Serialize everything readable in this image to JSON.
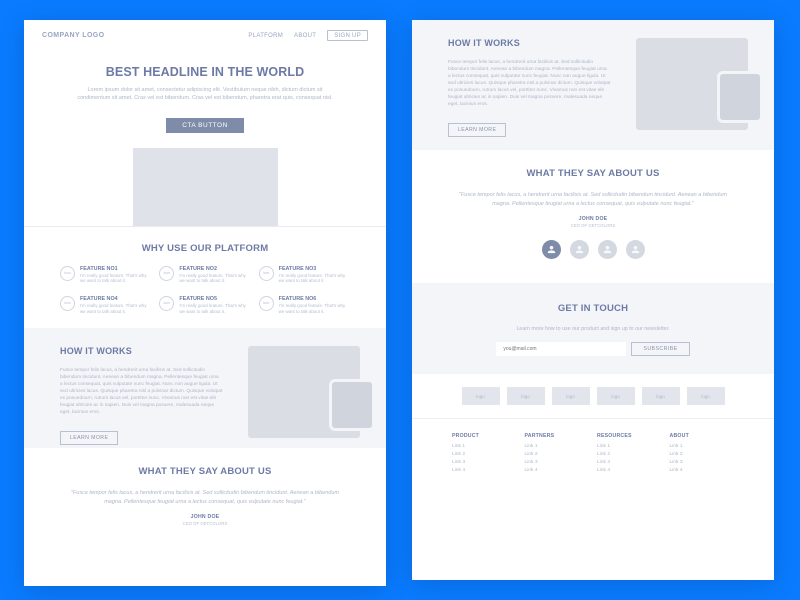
{
  "nav": {
    "logo": "COMPANY LOGO",
    "platform": "PLATFORM",
    "about": "ABOUT",
    "signup": "SIGN UP"
  },
  "hero": {
    "headline": "BEST HEADLINE IN THE WORLD",
    "lead": "Lorem ipsum dolor sit amet, consectetur adipiscing elit. Vestibulum neque nibh, dictum dictum sit condimentum sit amet. Cras vel est bibendum. Cras vel est bibendum, pharetra erat quis, consequat nisl.",
    "cta": "CTA BUTTON"
  },
  "features": {
    "heading": "WHY USE OUR PLATFORM",
    "icon": "icon",
    "items": [
      {
        "t": "FEATURE NO1",
        "d": "I'm really good feature. That's why we want to talk about it."
      },
      {
        "t": "FEATURE NO2",
        "d": "I'm really good feature. That's why we want to talk about it."
      },
      {
        "t": "FEATURE NO3",
        "d": "I'm really good feature. That's why we want to talk about it."
      },
      {
        "t": "FEATURE NO4",
        "d": "I'm really good feature. That's why we want to talk about it."
      },
      {
        "t": "FEATURE NO5",
        "d": "I'm really good feature. That's why we want to talk about it."
      },
      {
        "t": "FEATURE NO6",
        "d": "I'm really good feature. That's why we want to talk about it."
      }
    ]
  },
  "how": {
    "heading": "HOW IT WORKS",
    "body": "Fusce tempor felis lacus, a hendrerit urna facilisis at. Sed sollicitudin bibendum tincidunt. Aenean a bibendum magna. Pellentesque feugiat urna a lectus consequat, quis vulputate nunc feugiat. Nunc non augue ligula. Ut sed ultricies lacus. Quisque pharetra nisl a pulvinar dictum. Quisque volutpat ex posuedourn, rutrum lacus vel, porttitor nunc. Vivamus non est vitae elit feugiat ultricies ac in sapien. Duis vel magna posuere, malesuada neque eget, lacinius eros.",
    "learn": "LEARN MORE"
  },
  "testimonial": {
    "heading": "WHAT THEY SAY ABOUT US",
    "quote": "\"Fusce tempor felis lacus, a hendrerit urna facilisis at. Sed sollicitudin bibendum tincidunt. Aenean a bibendum magna. Pellentesque feugiat urna a lectus consequat, quis vulputate nunc feugiat.\"",
    "author": "JOHN DOE",
    "role": "CEO OF GETCOLORS"
  },
  "touch": {
    "heading": "GET IN TOUCH",
    "sub": "Learn more how to use our product and sign up to our newsletter.",
    "placeholder": "you@mail.com",
    "btn": "SUBSCRIBE"
  },
  "logos": [
    "logo",
    "logo",
    "logo",
    "logo",
    "logo",
    "logo"
  ],
  "footer": [
    {
      "h": "PRODUCT",
      "l": [
        "Link 1",
        "Link 2",
        "Link 3",
        "Link 4"
      ]
    },
    {
      "h": "PARTNERS",
      "l": [
        "Link 1",
        "Link 2",
        "Link 3",
        "Link 4"
      ]
    },
    {
      "h": "RESOURCES",
      "l": [
        "Link 1",
        "Link 2",
        "Link 3",
        "Link 4"
      ]
    },
    {
      "h": "ABOUT",
      "l": [
        "Link 1",
        "Link 2",
        "Link 3",
        "Link 4"
      ]
    }
  ]
}
